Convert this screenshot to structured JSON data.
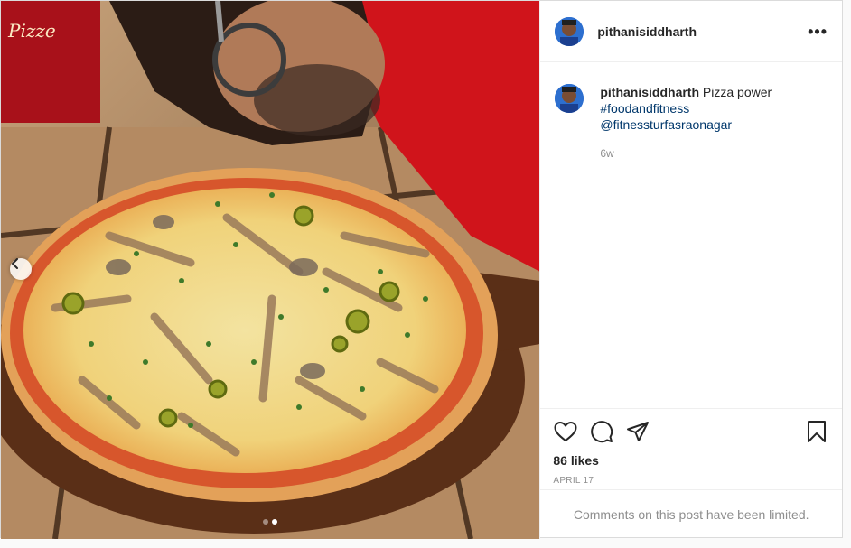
{
  "post": {
    "username": "pithanisiddharth",
    "more_label": "•••",
    "caption_text": "Pizza power",
    "caption_links": [
      "#foodandfitness",
      "@fitnessturfasraonagar"
    ],
    "time_ago": "6w",
    "likes": "86 likes",
    "date": "APRIL 17",
    "comment_notice": "Comments on this post have been limited."
  },
  "carousel": {
    "slide_count": 2,
    "active_slide": 2
  },
  "icons": {
    "like": "heart-icon",
    "comment": "comment-bubble-icon",
    "share": "paper-plane-icon",
    "save": "bookmark-icon",
    "prev": "chevron-left-icon"
  },
  "colors": {
    "link": "#00376b",
    "muted": "#8e8e8e",
    "border": "#dbdbdb"
  }
}
